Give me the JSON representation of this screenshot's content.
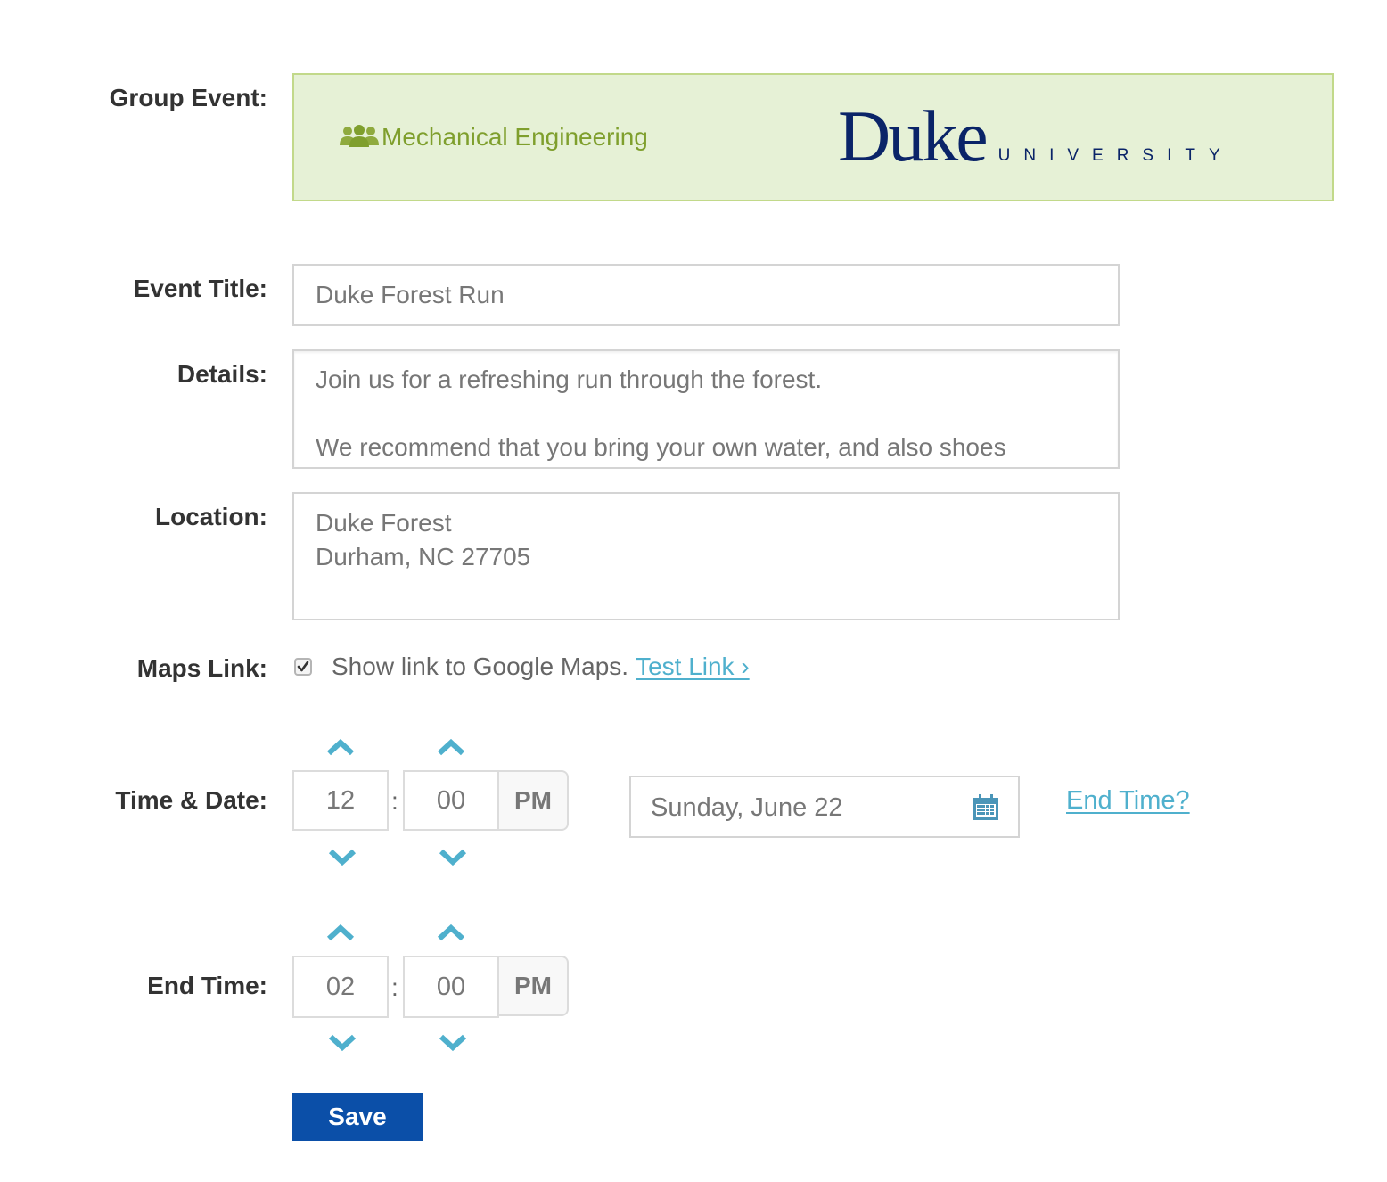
{
  "group_event": {
    "label": "Group Event:",
    "group_name": "Mechanical Engineering",
    "logo_word": "Duke",
    "logo_sub": "UNIVERSITY"
  },
  "event_title": {
    "label": "Event Title:",
    "value": "Duke Forest Run"
  },
  "details": {
    "label": "Details:",
    "line1": "Join us for a refreshing run through the forest.",
    "line2": "We recommend that you bring your own water, and also shoes"
  },
  "location": {
    "label": "Location:",
    "line1": "Duke Forest",
    "line2": "Durham, NC 27705"
  },
  "maps_link": {
    "label": "Maps Link:",
    "checked": true,
    "text": "Show link to Google Maps.",
    "link_text": "Test Link ›"
  },
  "time_date": {
    "label": "Time & Date:",
    "hour": "12",
    "separator": ":",
    "minute": "00",
    "ampm": "PM",
    "date": "Sunday, June 22",
    "end_time_link": "End Time?"
  },
  "end_time": {
    "label": "End Time:",
    "hour": "02",
    "separator": ":",
    "minute": "00",
    "ampm": "PM"
  },
  "save_button": "Save",
  "colors": {
    "accent_link": "#4fb0cd",
    "group_green": "#7f9f2d",
    "banner_bg": "#e6f1d6",
    "duke_navy": "#0a2468",
    "save_blue": "#0b4fa8"
  }
}
